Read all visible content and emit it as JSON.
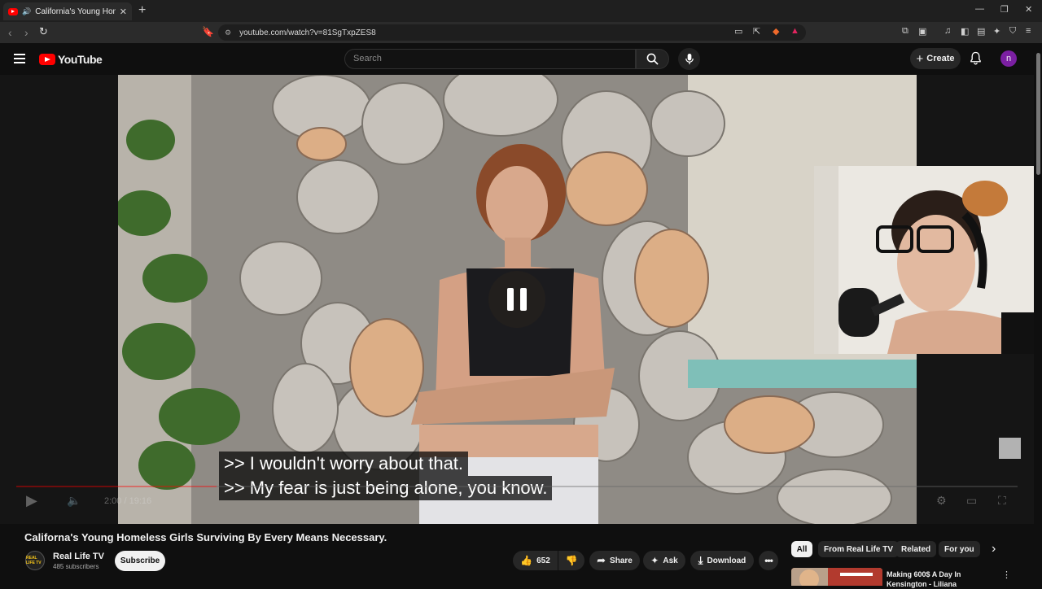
{
  "browser": {
    "tab_title": "California's Young Homeless G",
    "new_tab": "+",
    "close_tab": "✕",
    "url": "youtube.com/watch?v=81SgTxpZES8",
    "window_controls": [
      "—",
      "❐",
      "✕"
    ]
  },
  "header": {
    "logo_text": "YouTube",
    "search_placeholder": "Search",
    "create_label": "Create",
    "avatar_letter": "n"
  },
  "player": {
    "caption_lines": [
      ">> I wouldn't worry about that.",
      ">> My fear is just being alone, you know."
    ],
    "time": "2:00 / 19:16"
  },
  "video": {
    "title": "Californa's Young Homeless Girls Surviving By Every Means Necessary.",
    "channel_name": "Real Life TV",
    "subscribers": "485 subscribers",
    "channel_badge": "REAL LIFE TV",
    "subscribe_label": "Subscribe",
    "likes": "652",
    "share_label": "Share",
    "ask_label": "Ask",
    "download_label": "Download"
  },
  "recommendations": {
    "chips": [
      "All",
      "From Real Life TV",
      "Related",
      "For you"
    ],
    "first_title": "Making 600$ A Day In Kensington - Liliana"
  },
  "colors": {
    "brand_red": "#ff0000",
    "avatar_purple": "#7b1fa2",
    "background": "#0f0f0f"
  }
}
